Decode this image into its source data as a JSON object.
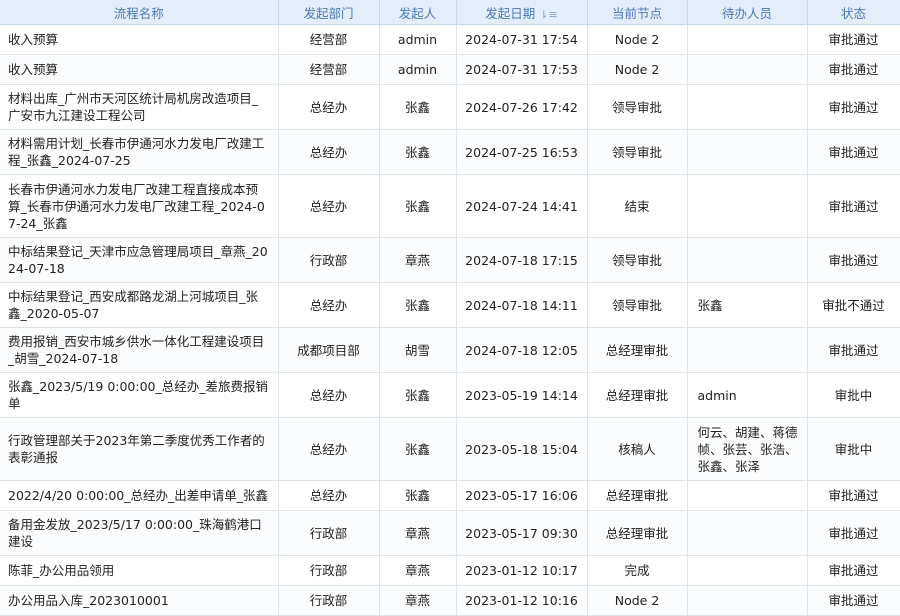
{
  "headers": [
    "流程名称",
    "发起部门",
    "发起人",
    "发起日期",
    "当前节点",
    "待办人员",
    "状态"
  ],
  "sort_icon": "sort-descending-icon",
  "rows": [
    {
      "name": "收入预算",
      "dept": "经营部",
      "initiator": "admin",
      "date": "2024-07-31 17:54",
      "node": "Node 2",
      "pending": "",
      "status": "审批通过"
    },
    {
      "name": "收入预算",
      "dept": "经营部",
      "initiator": "admin",
      "date": "2024-07-31 17:53",
      "node": "Node 2",
      "pending": "",
      "status": "审批通过"
    },
    {
      "name": "材料出库_广州市天河区统计局机房改造项目_广安市九江建设工程公司",
      "dept": "总经办",
      "initiator": "张鑫",
      "date": "2024-07-26 17:42",
      "node": "领导审批",
      "pending": "",
      "status": "审批通过"
    },
    {
      "name": "材料需用计划_长春市伊通河水力发电厂改建工程_张鑫_2024-07-25",
      "dept": "总经办",
      "initiator": "张鑫",
      "date": "2024-07-25 16:53",
      "node": "领导审批",
      "pending": "",
      "status": "审批通过"
    },
    {
      "name": "长春市伊通河水力发电厂改建工程直接成本预算_长春市伊通河水力发电厂改建工程_2024-07-24_张鑫",
      "dept": "总经办",
      "initiator": "张鑫",
      "date": "2024-07-24 14:41",
      "node": "结束",
      "pending": "",
      "status": "审批通过"
    },
    {
      "name": "中标结果登记_天津市应急管理局项目_章燕_2024-07-18",
      "dept": "行政部",
      "initiator": "章燕",
      "date": "2024-07-18 17:15",
      "node": "领导审批",
      "pending": "",
      "status": "审批通过"
    },
    {
      "name": "中标结果登记_西安成都路龙湖上河城项目_张鑫_2020-05-07",
      "dept": "总经办",
      "initiator": "张鑫",
      "date": "2024-07-18 14:11",
      "node": "领导审批",
      "pending": "张鑫",
      "status": "审批不通过"
    },
    {
      "name": "费用报销_西安市城乡供水一体化工程建设项目_胡雪_2024-07-18",
      "dept": "成都项目部",
      "initiator": "胡雪",
      "date": "2024-07-18 12:05",
      "node": "总经理审批",
      "pending": "",
      "status": "审批通过"
    },
    {
      "name": "张鑫_2023/5/19 0:00:00_总经办_差旅费报销单",
      "dept": "总经办",
      "initiator": "张鑫",
      "date": "2023-05-19 14:14",
      "node": "总经理审批",
      "pending": "admin",
      "status": "审批中"
    },
    {
      "name": "行政管理部关于2023年第二季度优秀工作者的表彰通报",
      "dept": "总经办",
      "initiator": "张鑫",
      "date": "2023-05-18 15:04",
      "node": "核稿人",
      "pending": "何云、胡建、蒋德帧、张芸、张浩、张鑫、张泽",
      "status": "审批中"
    },
    {
      "name": "2022/4/20 0:00:00_总经办_出差申请单_张鑫",
      "dept": "总经办",
      "initiator": "张鑫",
      "date": "2023-05-17 16:06",
      "node": "总经理审批",
      "pending": "",
      "status": "审批通过"
    },
    {
      "name": "备用金发放_2023/5/17 0:00:00_珠海鹤港口建设",
      "dept": "行政部",
      "initiator": "章燕",
      "date": "2023-05-17 09:30",
      "node": "总经理审批",
      "pending": "",
      "status": "审批通过"
    },
    {
      "name": "陈菲_办公用品领用",
      "dept": "行政部",
      "initiator": "章燕",
      "date": "2023-01-12 10:17",
      "node": "完成",
      "pending": "",
      "status": "审批通过"
    },
    {
      "name": "办公用品入库_2023010001",
      "dept": "行政部",
      "initiator": "章燕",
      "date": "2023-01-12 10:16",
      "node": "Node 2",
      "pending": "",
      "status": "审批通过"
    }
  ]
}
